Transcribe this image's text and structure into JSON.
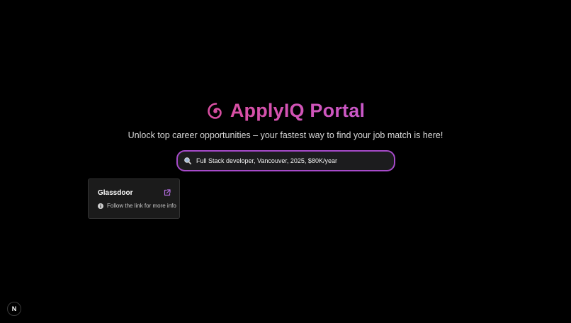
{
  "header": {
    "logo_icon": "spiral-icon",
    "title": "ApplyIQ Portal",
    "subtitle": "Unlock top career opportunities – your fastest way to find your job match is here!"
  },
  "search": {
    "icon": "search-icon",
    "value": "Full Stack developer, Vancouver, 2025, $80K/year"
  },
  "results": [
    {
      "title": "Glassdoor",
      "link_icon": "external-link-icon",
      "info_icon": "info-icon",
      "info_text": "Follow the link for more info"
    }
  ],
  "dev_badge": {
    "label": "N"
  },
  "colors": {
    "background": "#000000",
    "accent": "#d94fa3",
    "search_border": "#a64ac9",
    "card_background": "#1b1b1b"
  }
}
